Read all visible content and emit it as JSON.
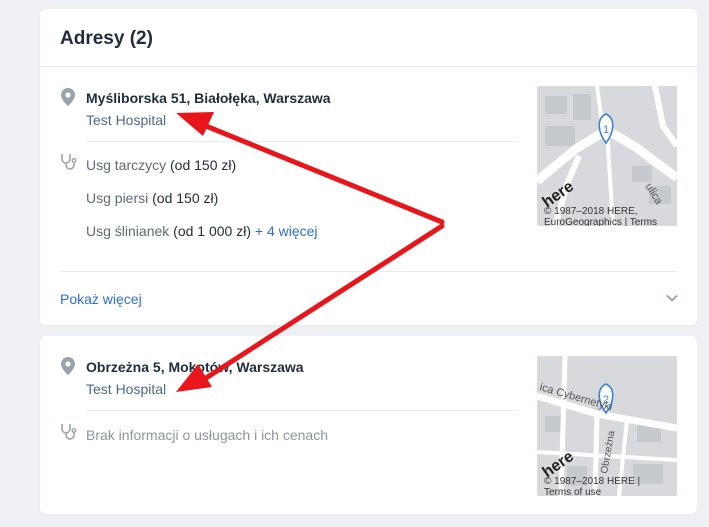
{
  "section": {
    "title": "Adresy (2)"
  },
  "addresses": [
    {
      "address": "Myśliborska 51, Białołęka, Warszawa",
      "facility": "Test Hospital",
      "services": [
        {
          "name": "Usg tarczycy",
          "price": "(od 150 zł)"
        },
        {
          "name": "Usg piersi",
          "price": "(od 150 zł)"
        },
        {
          "name": "Usg ślinianek",
          "price": "(od 1 000 zł)"
        }
      ],
      "more_services": "+ 4 więcej",
      "show_more": "Pokaż więcej",
      "map": {
        "marker": "1",
        "copyright_line1": "© 1987–2018 HERE,",
        "copyright_line2": "EuroGeographics | Terms",
        "logo": "here",
        "street": "ulica"
      }
    },
    {
      "address": "Obrzeżna 5, Mokotów, Warszawa",
      "facility": "Test Hospital",
      "no_services": "Brak informacji o usługach i ich cenach",
      "map": {
        "marker": "2",
        "copyright_line1": "© 1987–2018 HERE |",
        "copyright_line2": "Terms of use",
        "logo": "here",
        "street": "ica Cybernetyki",
        "street2": "Obrzeżna"
      }
    }
  ],
  "icons": {
    "location": "map-pin-icon",
    "services": "stethoscope-icon",
    "expand": "chevron-down-icon"
  },
  "colors": {
    "link": "#2a6fc9",
    "annotation_arrow": "#e8161b",
    "marker": "#3b82d6"
  }
}
